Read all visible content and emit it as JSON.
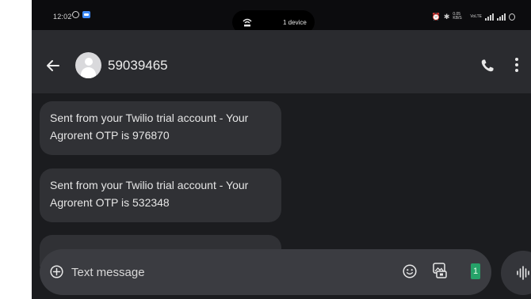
{
  "status_bar": {
    "time": "12:02",
    "pill_text": "1 device",
    "network_speed": "0.05 KB/S",
    "network_type": "VoLTE"
  },
  "app_bar": {
    "contact_name": "59039465"
  },
  "messages": [
    {
      "line1": "Sent from your Twilio trial account - Your",
      "line2": "Agrorent OTP is 976870"
    },
    {
      "line1": "Sent from your Twilio trial account - Your",
      "line2": "Agrorent OTP is 532348"
    }
  ],
  "compose": {
    "placeholder": "Text message",
    "sim_label": "1"
  },
  "icons": {
    "back": "arrow-left-icon",
    "call": "phone-icon",
    "menu": "more-vert-icon",
    "add": "add-circle-icon",
    "emoji": "emoji-icon",
    "gallery": "gallery-icon",
    "voice": "voice-wave-icon"
  },
  "colors": {
    "background": "#1b1c1f",
    "bubble": "#303135",
    "sim_badge": "#26a269",
    "status_msgapp": "#3d8af7"
  }
}
